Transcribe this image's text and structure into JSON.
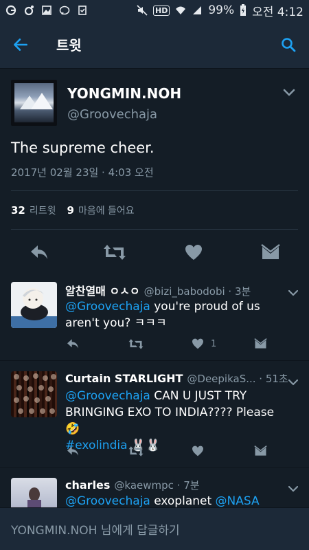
{
  "status": {
    "battery": "99%",
    "time": "오전 4:12",
    "network_badge": "HD"
  },
  "header": {
    "title": "트윗"
  },
  "tweet": {
    "display_name": "YONGMIN.NOH",
    "handle": "@Groovechaja",
    "text": "The supreme cheer.",
    "timestamp": "2017년 02월 23일 · 4:03 오전",
    "retweets_count": "32",
    "retweets_label": "리트윗",
    "likes_count": "9",
    "likes_label": "마음에 들어요"
  },
  "replies": [
    {
      "name": "알찬열매 ㅇㅅㅇ",
      "meta": "@bizi_babodobi · 3분",
      "mention": "@Groovechaja",
      "text_rest": " you're proud of us aren't you? ㅋㅋㅋ",
      "like_count": "1"
    },
    {
      "name": "Curtain STARLIGHT",
      "meta": "@DeepikaS... · 51초",
      "mention": "@Groovechaja",
      "text_rest": " CAN U JUST TRY BRINGING EXO TO INDIA???? Please 🤣",
      "hashtag": "#exolindia",
      "emoji": "🐰🐰"
    },
    {
      "name": "charles",
      "meta": "@kaewmpc · 7분",
      "mention": "@Groovechaja",
      "text_mid": " exoplanet ",
      "mention2": "@NASA"
    }
  ],
  "compose": {
    "placeholder": "YONGMIN.NOH 님에게 답글하기"
  },
  "colors": {
    "background": "#141d26",
    "bar": "#1c2938",
    "accent": "#1da1f2",
    "muted": "#8899a6"
  }
}
